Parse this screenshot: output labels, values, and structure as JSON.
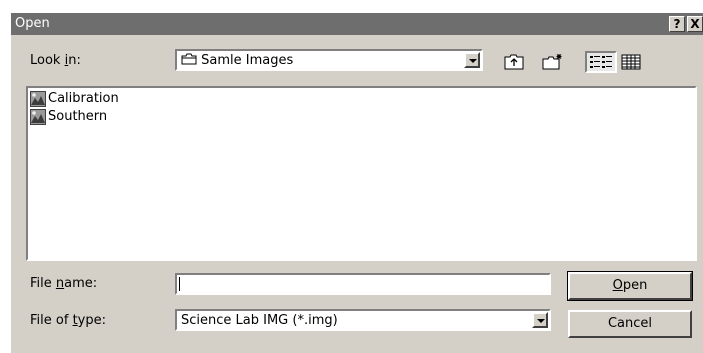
{
  "window": {
    "title": "Open",
    "help_label": "?",
    "close_label": "X"
  },
  "look_in": {
    "label": "Look in:",
    "value": "Samle Images"
  },
  "toolbar": {
    "icons": [
      "up-one-level-icon",
      "create-new-folder-icon",
      "list-view-icon",
      "details-view-icon"
    ]
  },
  "files": [
    {
      "name": "Calibration",
      "icon": "image-file-icon"
    },
    {
      "name": "Southern",
      "icon": "image-file-icon"
    }
  ],
  "file_name": {
    "label": "File name:",
    "value": ""
  },
  "file_type": {
    "label": "File of type:",
    "value": "Science Lab IMG (*.img)"
  },
  "buttons": {
    "open": "Open",
    "cancel": "Cancel"
  }
}
